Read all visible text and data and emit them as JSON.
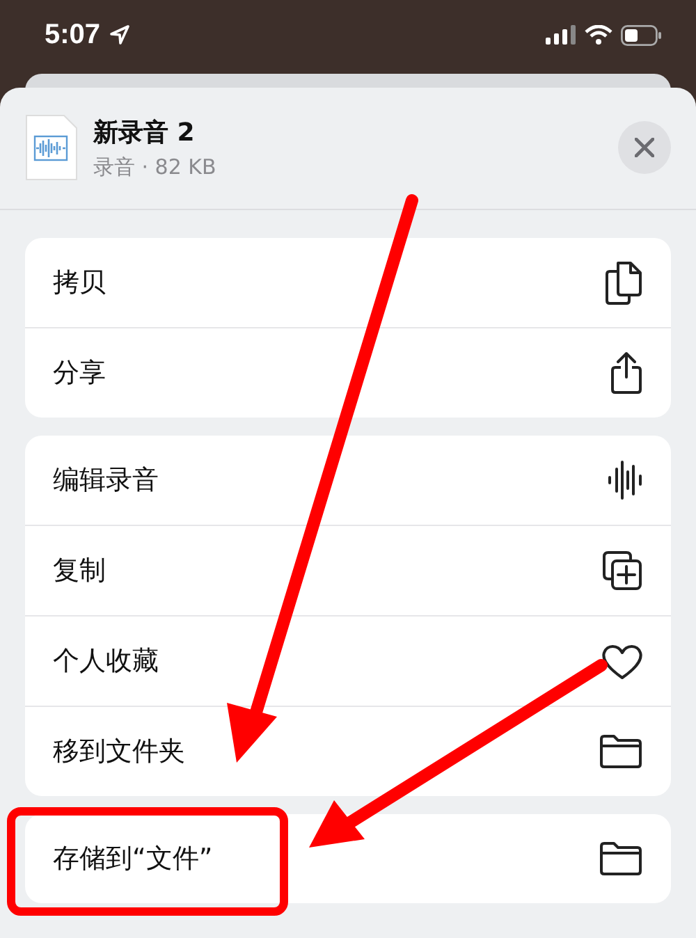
{
  "status_bar": {
    "time": "5:07"
  },
  "sheet": {
    "file": {
      "title": "新录音 2",
      "subtitle": "录音 · 82 KB"
    },
    "action_groups": [
      {
        "actions": [
          {
            "label": "拷贝",
            "kind": "copy"
          },
          {
            "label": "分享",
            "kind": "share"
          }
        ]
      },
      {
        "actions": [
          {
            "label": "编辑录音",
            "kind": "waveform"
          },
          {
            "label": "复制",
            "kind": "duplicate"
          },
          {
            "label": "个人收藏",
            "kind": "heart"
          },
          {
            "label": "移到文件夹",
            "kind": "folder"
          }
        ]
      },
      {
        "actions": [
          {
            "label": "存储到“文件”",
            "kind": "folder"
          }
        ]
      }
    ]
  }
}
